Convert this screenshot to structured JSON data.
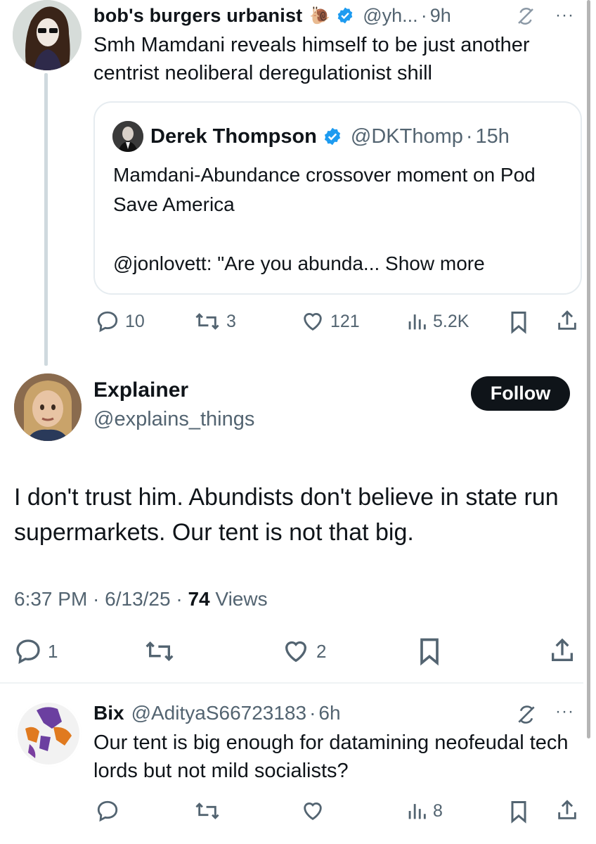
{
  "thread_tweet": {
    "display_name": "bob's burgers urbanist",
    "name_emoji": "🐌",
    "handle": "@yh...",
    "separator": "·",
    "time": "9h",
    "text": "Smh Mamdani reveals himself to be just another centrist neoliberal deregulationist shill",
    "more_label": "···",
    "quote": {
      "display_name": "Derek Thompson",
      "handle": "@DKThomp",
      "separator": "·",
      "time": "15h",
      "line1": "Mamdani-Abundance crossover moment on Pod Save America",
      "line2": "@jonlovett: \"Are you abunda...",
      "show_more": "Show more"
    },
    "actions": {
      "replies": "10",
      "reposts": "3",
      "likes": "121",
      "views": "5.2K"
    }
  },
  "main_tweet": {
    "display_name": "Explainer",
    "handle": "@explains_things",
    "follow_label": "Follow",
    "text": "I don't trust him. Abundists don't believe in state run supermarkets. Our tent is not that big.",
    "timestamp": "6:37 PM · 6/13/25 ·",
    "views_count": "74",
    "views_label": "Views",
    "actions": {
      "replies": "1",
      "likes": "2"
    }
  },
  "reply_tweet": {
    "display_name": "Bix",
    "handle": "@AdityaS66723183",
    "separator": "·",
    "time": "6h",
    "text": "Our tent is big enough for datamining neofeudal tech lords but not mild socialists?",
    "more_label": "···",
    "actions": {
      "views": "8"
    }
  },
  "colors": {
    "text": "#0f1419",
    "secondary": "#536471",
    "verified": "#1d9bf0",
    "border": "#e6ecf0",
    "follow_bg": "#0f1419"
  },
  "icons": [
    "reply-icon",
    "repost-icon",
    "like-icon",
    "views-icon",
    "bookmark-icon",
    "share-icon",
    "verified-badge-icon",
    "grok-icon"
  ]
}
